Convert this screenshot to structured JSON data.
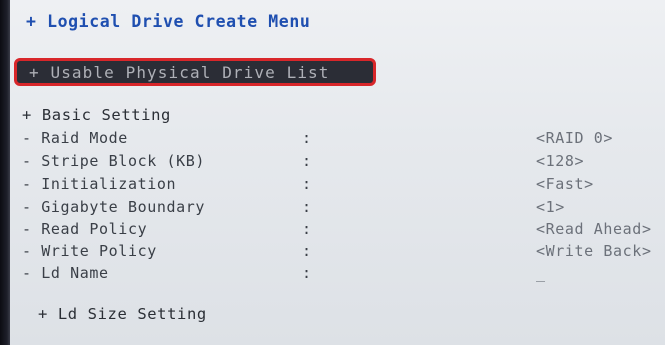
{
  "menu": {
    "title": "+ Logical Drive Create Menu",
    "selected_item": "+ Usable Physical Drive List"
  },
  "basic_setting": {
    "header": "+ Basic Setting",
    "rows": [
      {
        "label": "- Raid Mode",
        "colon": ":",
        "value": "<RAID 0>"
      },
      {
        "label": "- Stripe Block (KB)",
        "colon": ":",
        "value": "<128>"
      },
      {
        "label": "- Initialization",
        "colon": ":",
        "value": "<Fast>"
      },
      {
        "label": "- Gigabyte Boundary",
        "colon": ":",
        "value": "<1>"
      },
      {
        "label": "- Read Policy",
        "colon": ":",
        "value": "<Read Ahead>"
      },
      {
        "label": "- Write Policy",
        "colon": ":",
        "value": "<Write Back>"
      },
      {
        "label": "- Ld Name",
        "colon": ":",
        "value": "_"
      }
    ]
  },
  "ld_size_setting": {
    "header": "+ Ld Size Setting"
  }
}
